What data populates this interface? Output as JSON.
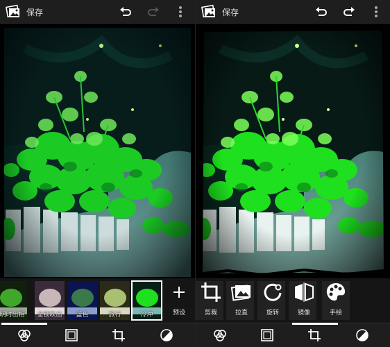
{
  "header": {
    "save_label": "保存",
    "icons": [
      "photo-app-icon",
      "undo-icon",
      "redo-icon",
      "more-vert-icon"
    ]
  },
  "left_panel": {
    "redo_enabled": false,
    "filters": [
      {
        "label": "明时出相",
        "selected": false
      },
      {
        "label": "全锁吹出",
        "selected": false
      },
      {
        "label": "蓝色",
        "selected": false
      },
      {
        "label": "旅行",
        "selected": false
      },
      {
        "label": "冷冲",
        "selected": true
      }
    ],
    "preset_label": "预设"
  },
  "right_panel": {
    "redo_enabled": true,
    "tools": [
      {
        "label": "剪裁",
        "icon": "crop-icon"
      },
      {
        "label": "拉直",
        "icon": "straighten-icon"
      },
      {
        "label": "旋转",
        "icon": "rotate-icon"
      },
      {
        "label": "镜像",
        "icon": "mirror-icon"
      },
      {
        "label": "手绘",
        "icon": "palette-icon"
      }
    ]
  },
  "bottom_tabs": [
    {
      "name": "filters",
      "icon": "filters-icon"
    },
    {
      "name": "borders",
      "icon": "frame-icon"
    },
    {
      "name": "geometry",
      "icon": "crop-icon"
    },
    {
      "name": "adjust",
      "icon": "exposure-icon"
    }
  ],
  "colors": {
    "bar": "#1e1e1e",
    "strip": "#151515",
    "accent": "#ffffff"
  }
}
